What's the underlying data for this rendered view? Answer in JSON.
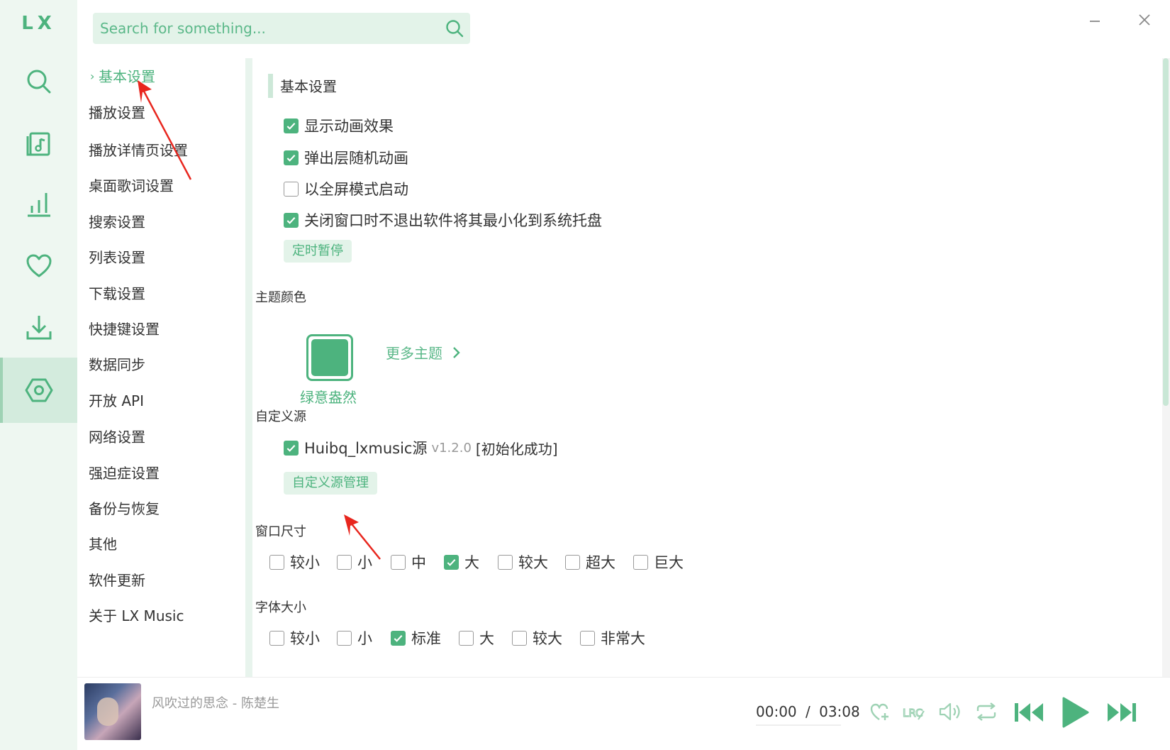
{
  "app": {
    "logo": "LX"
  },
  "search": {
    "placeholder": "Search for something..."
  },
  "nav": {
    "items": [
      {
        "label": "基本设置",
        "active": true
      },
      {
        "label": "播放设置"
      },
      {
        "label": "播放详情页设置"
      },
      {
        "label": "桌面歌词设置"
      },
      {
        "label": "搜索设置"
      },
      {
        "label": "列表设置"
      },
      {
        "label": "下载设置"
      },
      {
        "label": "快捷键设置"
      },
      {
        "label": "数据同步"
      },
      {
        "label": "开放 API"
      },
      {
        "label": "网络设置"
      },
      {
        "label": "强迫症设置"
      },
      {
        "label": "备份与恢复"
      },
      {
        "label": "其他"
      },
      {
        "label": "软件更新"
      },
      {
        "label": "关于 LX Music"
      }
    ]
  },
  "basic": {
    "title": "基本设置",
    "options": [
      {
        "label": "显示动画效果",
        "checked": true
      },
      {
        "label": "弹出层随机动画",
        "checked": true
      },
      {
        "label": "以全屏模式启动",
        "checked": false
      },
      {
        "label": "关闭窗口时不退出软件将其最小化到系统托盘",
        "checked": true
      }
    ],
    "timer_button": "定时暂停"
  },
  "theme": {
    "label": "主题颜色",
    "current": "绿意盎然",
    "more": "更多主题",
    "color": "#4db37e"
  },
  "custom_source": {
    "label": "自定义源",
    "source_name": "Huibq_lxmusic源",
    "version": "v1.2.0",
    "status": "[初始化成功]",
    "checked": true,
    "manage_button": "自定义源管理"
  },
  "window_size": {
    "label": "窗口尺寸",
    "options": [
      {
        "label": "较小",
        "checked": false
      },
      {
        "label": "小",
        "checked": false
      },
      {
        "label": "中",
        "checked": false
      },
      {
        "label": "大",
        "checked": true
      },
      {
        "label": "较大",
        "checked": false
      },
      {
        "label": "超大",
        "checked": false
      },
      {
        "label": "巨大",
        "checked": false
      }
    ]
  },
  "font_size": {
    "label": "字体大小",
    "options": [
      {
        "label": "较小",
        "checked": false
      },
      {
        "label": "小",
        "checked": false
      },
      {
        "label": "标准",
        "checked": true
      },
      {
        "label": "大",
        "checked": false
      },
      {
        "label": "较大",
        "checked": false
      },
      {
        "label": "非常大",
        "checked": false
      }
    ]
  },
  "player": {
    "song": "风吹过的思念 - 陈楚生",
    "current_time": "00:00",
    "separator": "/",
    "total_time": "03:08",
    "progress": 0
  },
  "colors": {
    "accent": "#4db37e",
    "annotation": "#e8261e"
  }
}
